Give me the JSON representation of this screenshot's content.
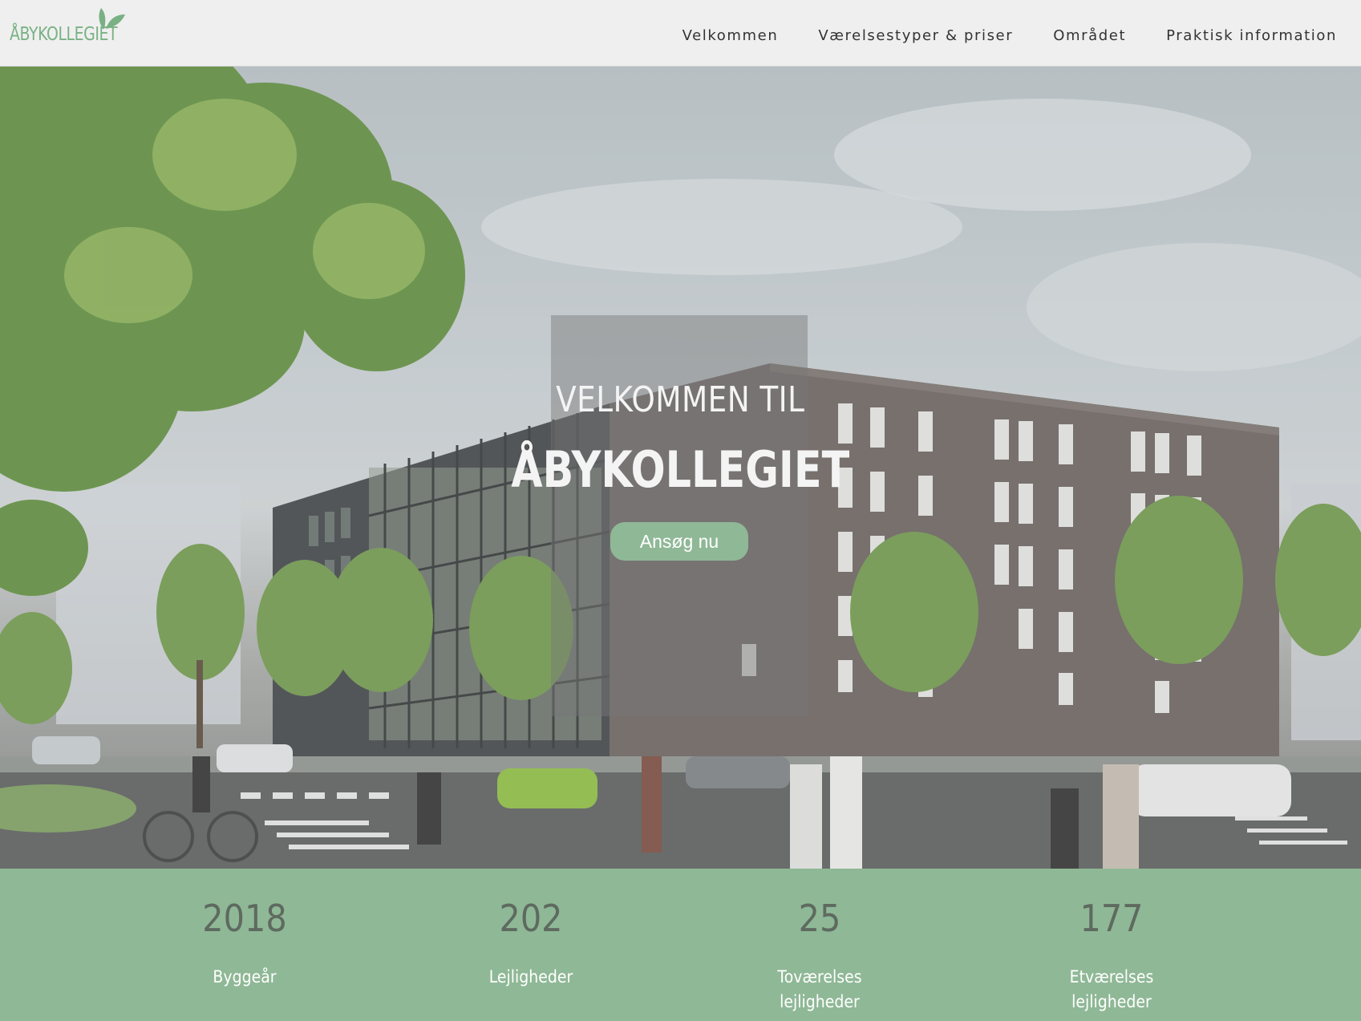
{
  "header": {
    "logo_text": "ÅBYKOLLEGIET",
    "nav": [
      {
        "label": "Velkommen"
      },
      {
        "label": "Værelsestyper & priser"
      },
      {
        "label": "Området"
      },
      {
        "label": "Praktisk information"
      }
    ]
  },
  "hero": {
    "title_line1": "VELKOMMEN TIL",
    "title_line2": "ÅBYKOLLEGIET",
    "cta_label": "Ansøg nu"
  },
  "stats": [
    {
      "number": "2018",
      "label_line1": "Byggeår",
      "label_line2": ""
    },
    {
      "number": "202",
      "label_line1": "Lejligheder",
      "label_line2": ""
    },
    {
      "number": "25",
      "label_line1": "Toværelses",
      "label_line2": "lejligheder"
    },
    {
      "number": "177",
      "label_line1": "Etværelses",
      "label_line2": "lejligheder"
    }
  ],
  "colors": {
    "brand_green": "#8fb896",
    "logo_green": "#79b184",
    "header_bg": "#efefef",
    "stat_number": "#5e6a60"
  }
}
